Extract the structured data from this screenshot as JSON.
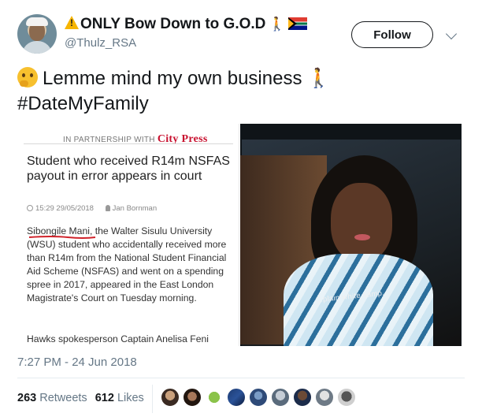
{
  "user": {
    "display_name": "ONLY Bow Down to G.O.D",
    "handle": "@Thulz_RSA",
    "icons": [
      "warning-icon",
      "person-walking-icon",
      "south-africa-flag-icon"
    ]
  },
  "follow_label": "Follow",
  "tweet": {
    "line1": "Lemme mind my own business",
    "line2": "#DateMyFamily",
    "icons": [
      "thinking-face-icon",
      "person-walking-icon"
    ]
  },
  "article": {
    "partner_prefix": "IN PARTNERSHIP WITH",
    "partner_brand": "City Press",
    "title": "Student who received R14m NSFAS payout in error appears in court",
    "time": "15:29 29/05/2018",
    "author": "Jan Bornman",
    "body_name": "Sibongile Mani",
    "body_rest": ", the Walter Sisulu University (WSU) student who accidentally received more than R14m from the National Student Financial Aid Scheme (NSFAS) and went on a spending spree in 2017, appeared in the East London Magistrate's Court on Tuesday morning.",
    "footer": "Hawks spokesperson Captain Anelisa Feni"
  },
  "video": {
    "subtitle": "...plain white samp."
  },
  "timestamp": "7:27 PM - 24 Jun 2018",
  "stats": {
    "retweets_count": "263",
    "retweets_label": "Retweets",
    "likes_count": "612",
    "likes_label": "Likes"
  },
  "colors": {
    "brand_red": "#c8102e",
    "muted": "#657786",
    "text": "#14171a",
    "underline": "#d0222a"
  }
}
